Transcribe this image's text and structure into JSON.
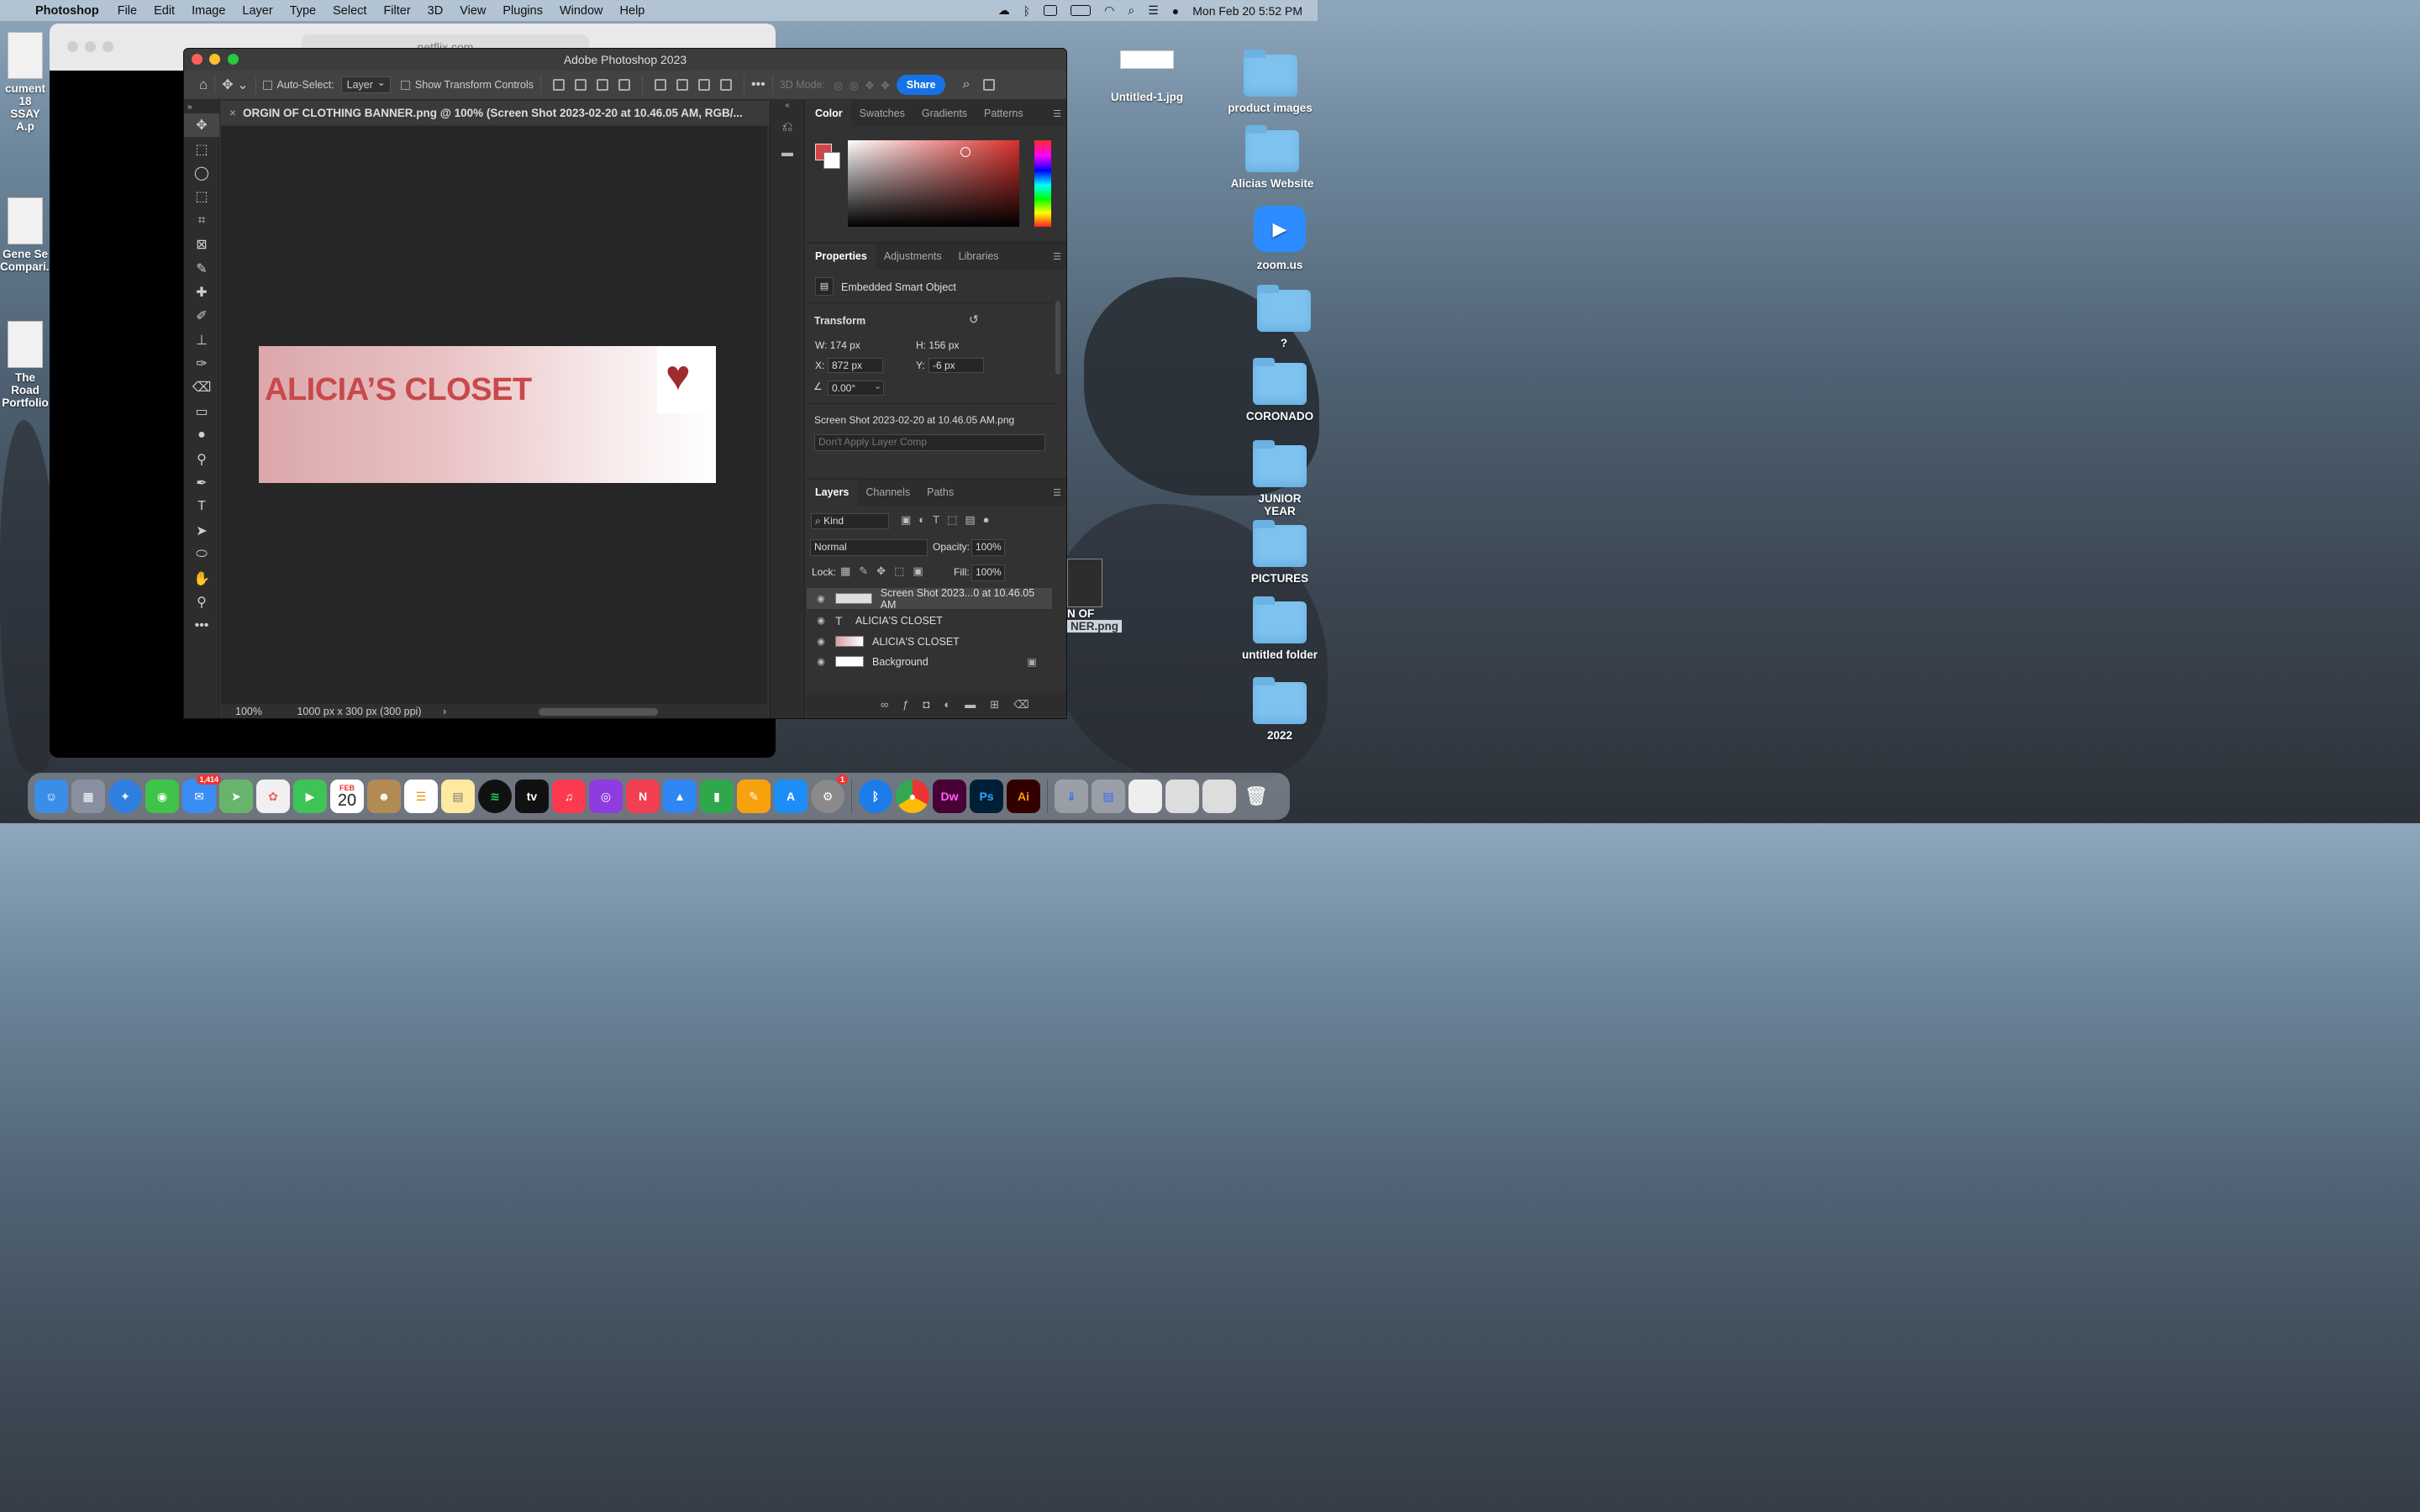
{
  "menubar": {
    "app": "Photoshop",
    "items": [
      "File",
      "Edit",
      "Image",
      "Layer",
      "Type",
      "Select",
      "Filter",
      "3D",
      "View",
      "Plugins",
      "Window",
      "Help"
    ],
    "datetime": "Mon Feb 20  5:52 PM"
  },
  "desktop": {
    "left_labels": [
      "cument 18",
      "SSAY A.p",
      "Gene Se",
      "Compari...",
      "The Road",
      "Portfolio"
    ],
    "right_items": [
      "Untitled-1.jpg",
      "product images",
      "Alicias Website",
      "zoom.us",
      "?",
      "CORONADO",
      "JUNIOR YEAR",
      "PICTURES",
      "untitled folder",
      "2022"
    ],
    "partial_file": [
      "N OF",
      "NER.png"
    ]
  },
  "safari": {
    "url": "netflix.com"
  },
  "photoshop": {
    "window_title": "Adobe Photoshop 2023",
    "options": {
      "auto_select_label": "Auto-Select:",
      "auto_select_value": "Layer",
      "show_transform": "Show Transform Controls",
      "mode3d": "3D Mode:",
      "share": "Share"
    },
    "doc_tab": "ORGIN OF CLOTHING BANNER.png @ 100% (Screen Shot 2023-02-20 at 10.46.05 AM, RGB/...",
    "banner_text": "ALICIA’S CLOSET",
    "status": {
      "zoom": "100%",
      "doc_size": "1000 px x 300 px (300 ppi)"
    },
    "color_panel": {
      "tabs": [
        "Color",
        "Swatches",
        "Gradients",
        "Patterns"
      ],
      "fg_color": "#d04545"
    },
    "properties": {
      "tabs": [
        "Properties",
        "Adjustments",
        "Libraries"
      ],
      "type": "Embedded Smart Object",
      "transform": "Transform",
      "w": "W:  174 px",
      "h": "H:  156 px",
      "x_label": "X:",
      "x_value": "872 px",
      "y_label": "Y:",
      "y_value": "-6 px",
      "angle": "0.00°",
      "source_file": "Screen Shot 2023-02-20 at 10.46.05 AM.png",
      "layer_comp": "Don't Apply Layer Comp"
    },
    "layers_panel": {
      "tabs": [
        "Layers",
        "Channels",
        "Paths"
      ],
      "kind": "Kind",
      "blend": "Normal",
      "opacity_label": "Opacity:",
      "opacity": "100%",
      "lock_label": "Lock:",
      "fill_label": "Fill:",
      "fill": "100%",
      "layers": [
        "Screen Shot 2023...0 at 10.46.05 AM",
        "ALICIA'S CLOSET",
        "ALICIA'S CLOSET",
        "Background"
      ]
    }
  },
  "dock": {
    "mail_badge": "1,414",
    "calendar_month": "FEB",
    "calendar_day": "20",
    "settings_badge": "1",
    "apps": [
      "Finder",
      "Launchpad",
      "Safari",
      "Messages",
      "Mail",
      "Maps",
      "Photos",
      "FaceTime",
      "Calendar",
      "Contacts",
      "Reminders",
      "Notes",
      "Spotify",
      "TV",
      "Music",
      "Podcasts",
      "News",
      "Keynote",
      "Numbers",
      "Pages",
      "App Store",
      "System Settings",
      "Bluetooth",
      "Chrome",
      "Dw",
      "Ps",
      "Ai",
      "Trash"
    ]
  }
}
